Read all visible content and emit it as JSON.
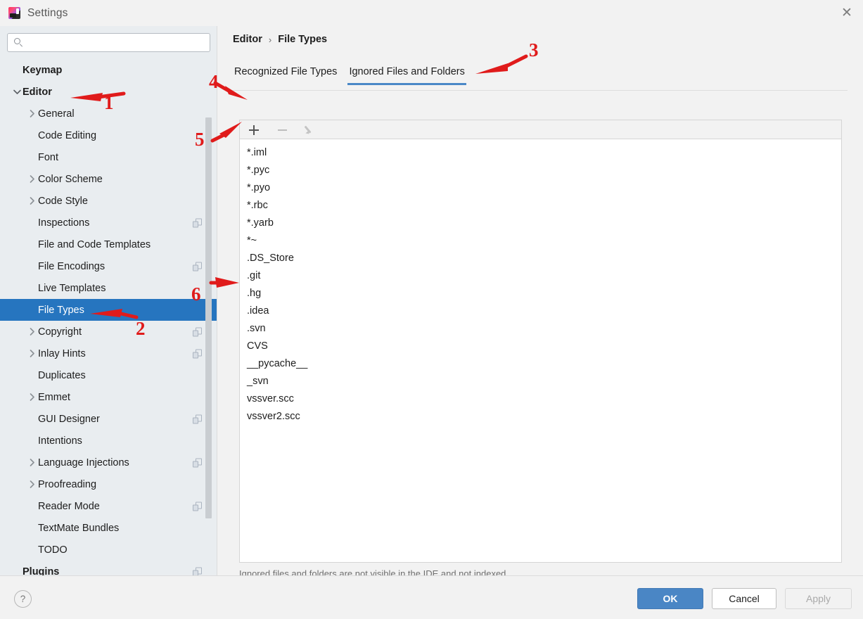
{
  "window": {
    "title": "Settings",
    "app_icon": "intellij-idea-icon",
    "close_icon": "close-icon"
  },
  "sidebar": {
    "search": {
      "value": "",
      "placeholder": "",
      "icon": "search-icon"
    },
    "items": [
      {
        "label": "Keymap",
        "indent": 0,
        "bold": true,
        "arrow": "none",
        "copy": false,
        "selected": false
      },
      {
        "label": "Editor",
        "indent": 0,
        "bold": true,
        "arrow": "expanded",
        "copy": false,
        "selected": false
      },
      {
        "label": "General",
        "indent": 1,
        "bold": false,
        "arrow": "collapsed",
        "copy": false,
        "selected": false
      },
      {
        "label": "Code Editing",
        "indent": 1,
        "bold": false,
        "arrow": "none",
        "copy": false,
        "selected": false
      },
      {
        "label": "Font",
        "indent": 1,
        "bold": false,
        "arrow": "none",
        "copy": false,
        "selected": false
      },
      {
        "label": "Color Scheme",
        "indent": 1,
        "bold": false,
        "arrow": "collapsed",
        "copy": false,
        "selected": false
      },
      {
        "label": "Code Style",
        "indent": 1,
        "bold": false,
        "arrow": "collapsed",
        "copy": false,
        "selected": false
      },
      {
        "label": "Inspections",
        "indent": 1,
        "bold": false,
        "arrow": "none",
        "copy": true,
        "selected": false
      },
      {
        "label": "File and Code Templates",
        "indent": 1,
        "bold": false,
        "arrow": "none",
        "copy": false,
        "selected": false
      },
      {
        "label": "File Encodings",
        "indent": 1,
        "bold": false,
        "arrow": "none",
        "copy": true,
        "selected": false
      },
      {
        "label": "Live Templates",
        "indent": 1,
        "bold": false,
        "arrow": "none",
        "copy": false,
        "selected": false
      },
      {
        "label": "File Types",
        "indent": 1,
        "bold": false,
        "arrow": "none",
        "copy": false,
        "selected": true
      },
      {
        "label": "Copyright",
        "indent": 1,
        "bold": false,
        "arrow": "collapsed",
        "copy": true,
        "selected": false
      },
      {
        "label": "Inlay Hints",
        "indent": 1,
        "bold": false,
        "arrow": "collapsed",
        "copy": true,
        "selected": false
      },
      {
        "label": "Duplicates",
        "indent": 1,
        "bold": false,
        "arrow": "none",
        "copy": false,
        "selected": false
      },
      {
        "label": "Emmet",
        "indent": 1,
        "bold": false,
        "arrow": "collapsed",
        "copy": false,
        "selected": false
      },
      {
        "label": "GUI Designer",
        "indent": 1,
        "bold": false,
        "arrow": "none",
        "copy": true,
        "selected": false
      },
      {
        "label": "Intentions",
        "indent": 1,
        "bold": false,
        "arrow": "none",
        "copy": false,
        "selected": false
      },
      {
        "label": "Language Injections",
        "indent": 1,
        "bold": false,
        "arrow": "collapsed",
        "copy": true,
        "selected": false
      },
      {
        "label": "Proofreading",
        "indent": 1,
        "bold": false,
        "arrow": "collapsed",
        "copy": false,
        "selected": false
      },
      {
        "label": "Reader Mode",
        "indent": 1,
        "bold": false,
        "arrow": "none",
        "copy": true,
        "selected": false
      },
      {
        "label": "TextMate Bundles",
        "indent": 1,
        "bold": false,
        "arrow": "none",
        "copy": false,
        "selected": false
      },
      {
        "label": "TODO",
        "indent": 1,
        "bold": false,
        "arrow": "none",
        "copy": false,
        "selected": false
      },
      {
        "label": "Plugins",
        "indent": 0,
        "bold": true,
        "arrow": "none",
        "copy": true,
        "selected": false
      }
    ]
  },
  "main": {
    "breadcrumb": {
      "parent": "Editor",
      "separator": "›",
      "current": "File Types"
    },
    "tabs": [
      {
        "label": "Recognized File Types",
        "active": false
      },
      {
        "label": "Ignored Files and Folders",
        "active": true
      }
    ],
    "toolbar": [
      {
        "icon": "plus-icon",
        "enabled": true
      },
      {
        "icon": "minus-icon",
        "enabled": false
      },
      {
        "icon": "pencil-icon",
        "enabled": false
      }
    ],
    "ignored_items": [
      "*.iml",
      "*.pyc",
      "*.pyo",
      "*.rbc",
      "*.yarb",
      "*~",
      ".DS_Store",
      ".git",
      ".hg",
      ".idea",
      ".svn",
      "CVS",
      "__pycache__",
      "_svn",
      "vssver.scc",
      "vssver2.scc"
    ],
    "hint": "Ignored files and folders are not visible in the IDE and not indexed"
  },
  "footer": {
    "help_label": "?",
    "ok_label": "OK",
    "cancel_label": "Cancel",
    "apply_label": "Apply"
  },
  "annotations": [
    {
      "number": "1"
    },
    {
      "number": "2"
    },
    {
      "number": "3"
    },
    {
      "number": "4"
    },
    {
      "number": "5"
    },
    {
      "number": "6"
    }
  ],
  "colors": {
    "selection_blue": "#2675bf",
    "tab_underline": "#4a88c7",
    "ok_button": "#4a86c5",
    "annotation_red": "#e01b1b",
    "sidebar_bg": "#e9edf0"
  }
}
